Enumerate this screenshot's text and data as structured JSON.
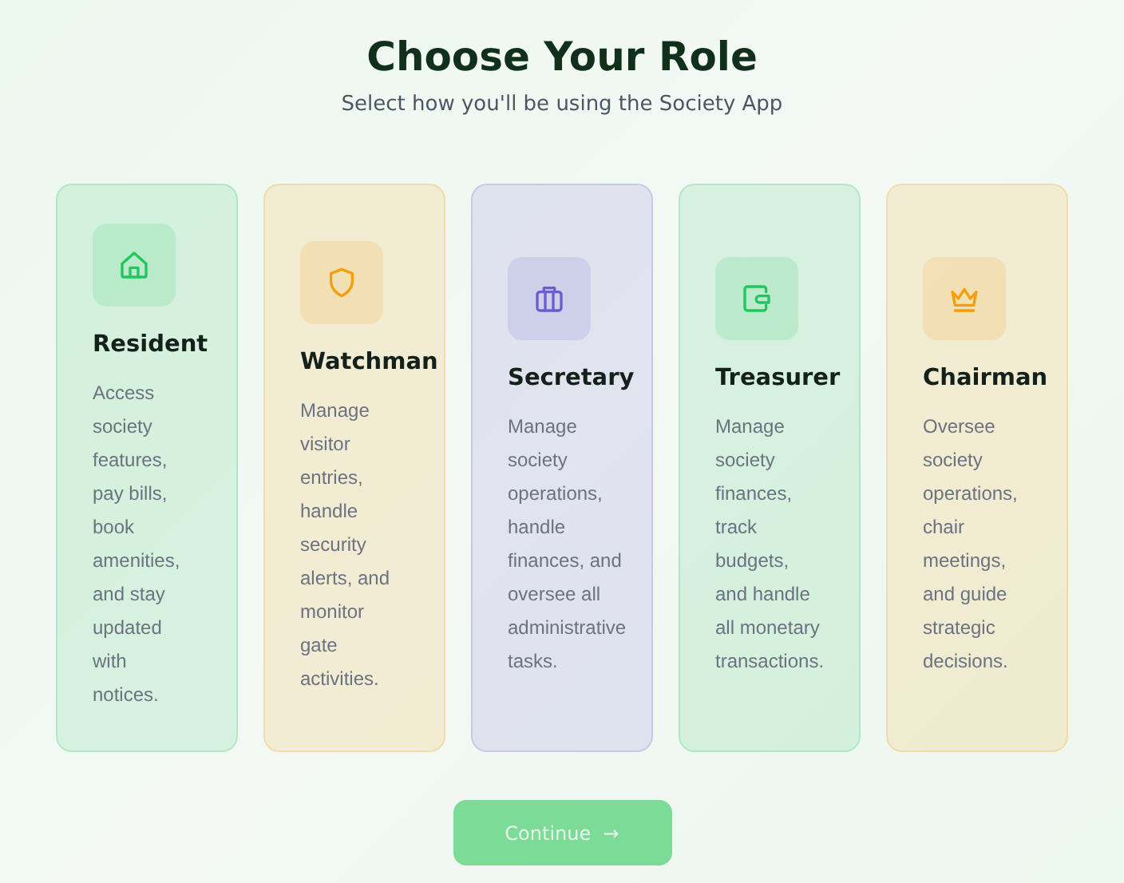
{
  "title": "Choose Your Role",
  "subtitle": "Select how you'll be using the Society App",
  "roles": [
    {
      "kind": "home",
      "name": "Resident",
      "description": "Access society features, pay bills, book amenities, and stay updated with notices.",
      "color": "#22c55e",
      "selected": false
    },
    {
      "kind": "shield",
      "name": "Watchman",
      "description": "Manage visitor entries, handle security alerts, and monitor gate activities.",
      "color": "#f59e0b",
      "selected": false
    },
    {
      "kind": "briefcase",
      "name": "Secretary",
      "description": "Manage society operations, handle finances, and oversee all administrative tasks.",
      "color": "#6d5bd0",
      "selected": false
    },
    {
      "kind": "wallet",
      "name": "Treasurer",
      "description": "Manage society finances, track budgets, and handle all monetary transactions.",
      "color": "#22c55e",
      "selected": false
    },
    {
      "kind": "crown",
      "name": "Chairman",
      "description": "Oversee society operations, chair meetings, and guide strategic decisions.",
      "color": "#f59e0b",
      "selected": false
    }
  ],
  "continue_button": {
    "label": "Continue",
    "arrow": "→",
    "disabled": true
  }
}
